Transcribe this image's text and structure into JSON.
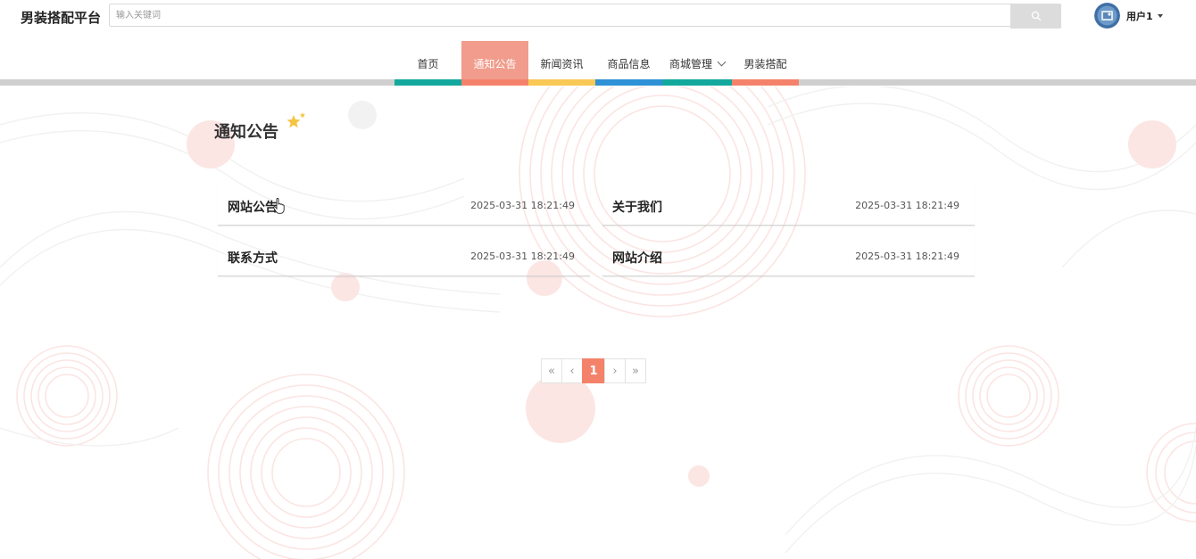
{
  "app": {
    "title": "男装搭配平台"
  },
  "search": {
    "placeholder": "输入关键词",
    "icon": "search-icon"
  },
  "user": {
    "name": "用户1"
  },
  "nav": {
    "items": [
      {
        "label": "首页",
        "color": "#13a89e",
        "active": false
      },
      {
        "label": "通知公告",
        "color": "#f4826b",
        "active": true
      },
      {
        "label": "新闻资讯",
        "color": "#f9c855",
        "active": false
      },
      {
        "label": "商品信息",
        "color": "#2f91d6",
        "active": false
      },
      {
        "label": "商城管理",
        "color": "#13a89e",
        "active": false,
        "dropdown": true
      },
      {
        "label": "男装搭配",
        "color": "#f4826b",
        "active": false
      }
    ]
  },
  "section": {
    "title": "通知公告"
  },
  "notices": [
    {
      "title": "网站公告",
      "time": "2025-03-31 18:21:49"
    },
    {
      "title": "关于我们",
      "time": "2025-03-31 18:21:49"
    },
    {
      "title": "联系方式",
      "time": "2025-03-31 18:21:49"
    },
    {
      "title": "网站介绍",
      "time": "2025-03-31 18:21:49"
    }
  ],
  "pagination": {
    "first": "«",
    "prev": "‹",
    "current": "1",
    "next": "›",
    "last": "»"
  },
  "colors": {
    "accent": "#f4826b",
    "active_nav_bg": "#f19c8c",
    "star": "#f5c542"
  }
}
